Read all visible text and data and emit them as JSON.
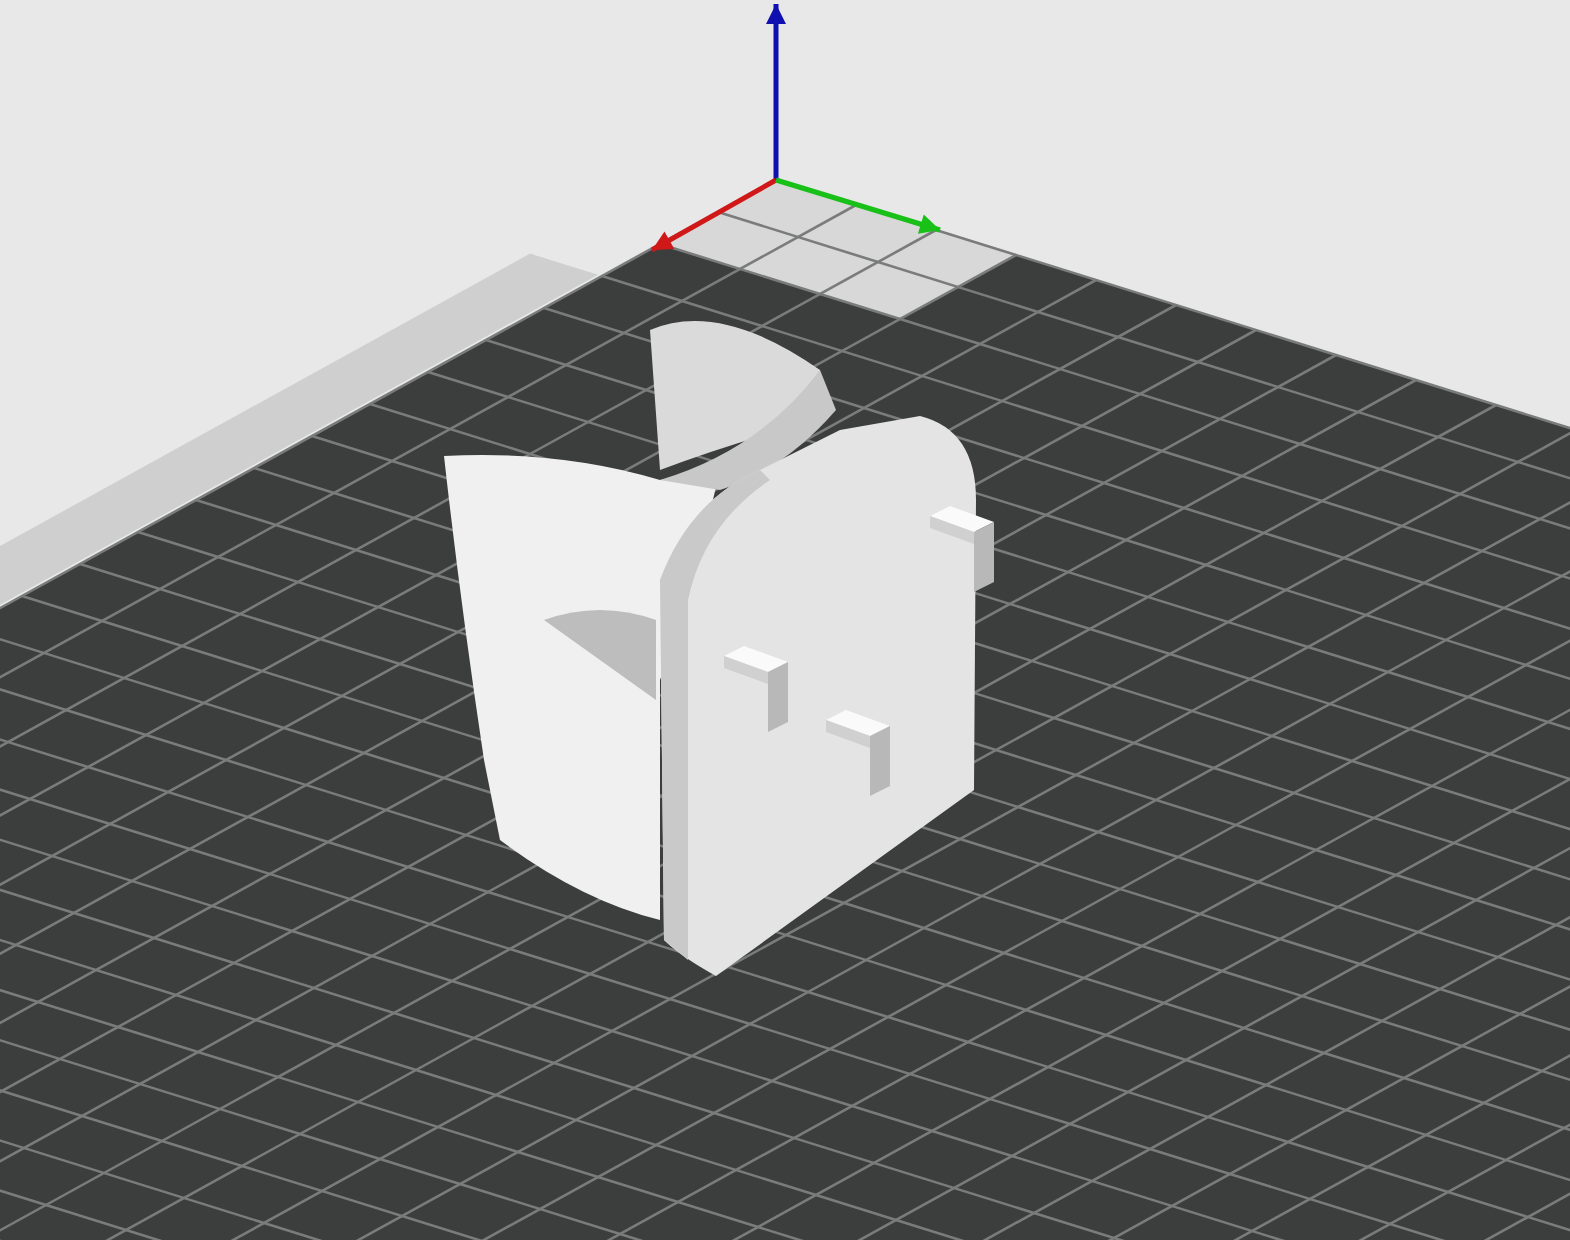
{
  "viewport": {
    "axes": [
      {
        "kind": "z",
        "color": "#1010b0"
      },
      {
        "kind": "x",
        "color": "#d01818"
      },
      {
        "kind": "y",
        "color": "#18c018"
      }
    ]
  }
}
